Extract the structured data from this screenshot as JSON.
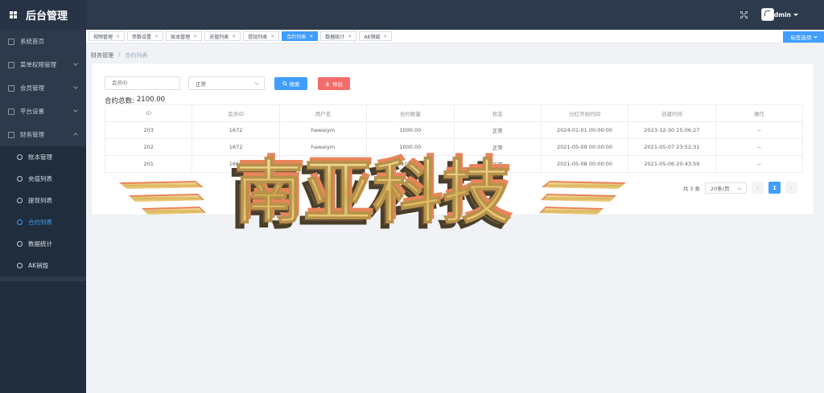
{
  "app": {
    "title": "后台管理"
  },
  "header": {
    "user_name": "admin"
  },
  "sidebar": {
    "items": [
      {
        "label": "系统首页"
      },
      {
        "label": "菜单权限管理"
      },
      {
        "label": "会员管理"
      },
      {
        "label": "平台设置"
      },
      {
        "label": "财务管理"
      }
    ],
    "sub_items": [
      {
        "label": "账本管理"
      },
      {
        "label": "充值列表"
      },
      {
        "label": "提现列表"
      },
      {
        "label": "合约列表"
      },
      {
        "label": "数据统计"
      },
      {
        "label": "AK销毁"
      }
    ]
  },
  "tags": [
    {
      "label": "视频管理"
    },
    {
      "label": "参数设置"
    },
    {
      "label": "账本管理"
    },
    {
      "label": "充值列表"
    },
    {
      "label": "提现列表"
    },
    {
      "label": "合约列表"
    },
    {
      "label": "数据统计"
    },
    {
      "label": "AK销毁"
    }
  ],
  "tags_close": "×",
  "tab_options_label": "标签选项",
  "breadcrumb": {
    "first": "财务管理",
    "sep": "/",
    "current": "合约列表"
  },
  "filters": {
    "member_id_placeholder": "会员ID",
    "status_value": "正常",
    "search_label": "搜索",
    "export_label": "导出"
  },
  "summary": {
    "label": "合约总数:",
    "value": "2100.00"
  },
  "table": {
    "headers": [
      "ID",
      "会员ID",
      "用户名",
      "合约数量",
      "状态",
      "分红开始时间",
      "创建时间",
      "操作"
    ],
    "rows": [
      [
        "203",
        "1672",
        "hawaiym",
        "1000.00",
        "正常",
        "2024-01-01 00:00:00",
        "2023-12-30 15:06:27",
        "--"
      ],
      [
        "202",
        "1672",
        "hawaiym",
        "1000.00",
        "正常",
        "2021-05-09 00:00:00",
        "2021-05-07 23:52:31",
        "--"
      ],
      [
        "201",
        "1669",
        "1",
        "100.00",
        "正常",
        "2021-05-08 00:00:00",
        "2021-05-06 20:43:59",
        "--"
      ]
    ]
  },
  "pager": {
    "total": "共 3 条",
    "page_size": "20条/页",
    "current": "1",
    "prev": "‹",
    "next": "›"
  },
  "watermark": {
    "text": "南亚科技"
  },
  "colors": {
    "primary": "#409eff",
    "danger": "#f56c6c",
    "sidebar": "#2d3a4b",
    "gold": "#e6c26a"
  }
}
